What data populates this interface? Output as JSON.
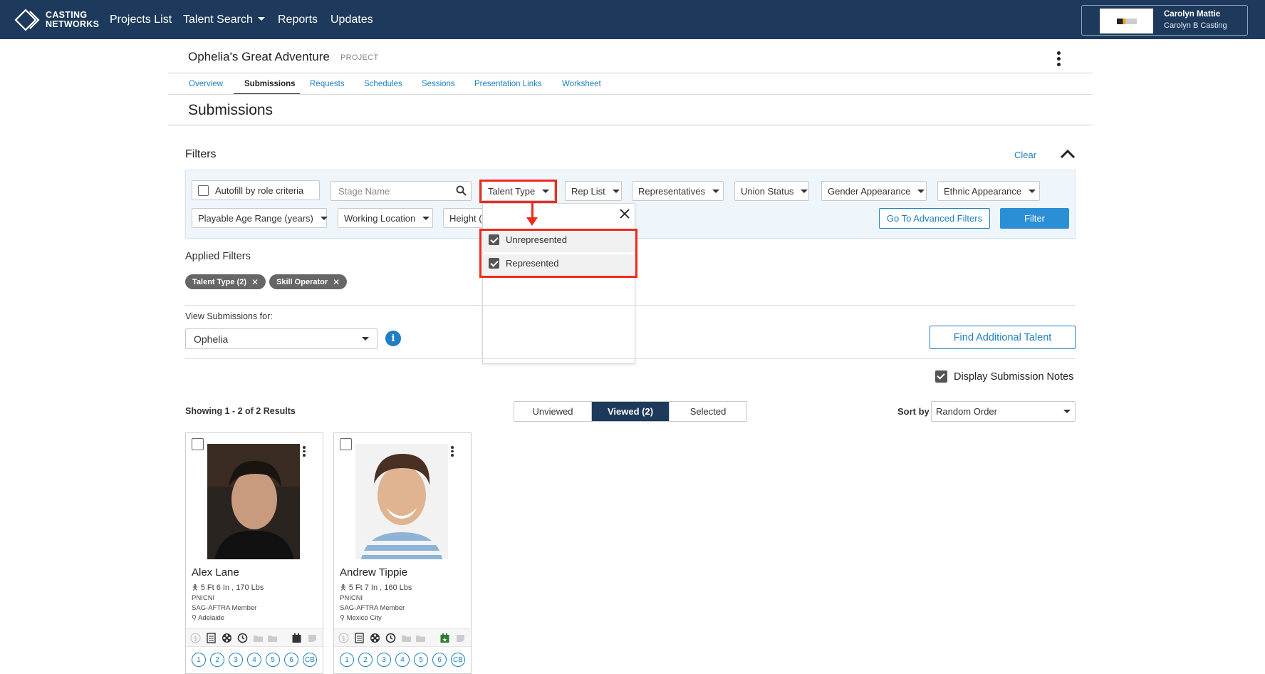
{
  "brand": {
    "line1": "CASTING",
    "line2": "NETWORKS"
  },
  "nav": {
    "projects": "Projects List",
    "talent_search": "Talent Search",
    "reports": "Reports",
    "updates": "Updates"
  },
  "account": {
    "name": "Carolyn Mattie",
    "company": "Carolyn B Casting"
  },
  "project": {
    "title": "Ophelia's Great Adventure",
    "label": "PROJECT"
  },
  "tabs": [
    "Overview",
    "Submissions",
    "Requests",
    "Schedules",
    "Sessions",
    "Presentation Links",
    "Worksheet"
  ],
  "section_title": "Submissions",
  "filters": {
    "title": "Filters",
    "clear": "Clear",
    "autofill": "Autofill by role criteria",
    "stage_name_placeholder": "Stage Name",
    "talent_type": "Talent Type",
    "rep_list": "Rep List",
    "representatives": "Representatives",
    "union_status": "Union Status",
    "gender_appearance": "Gender Appearance",
    "ethnic_appearance": "Ethnic Appearance",
    "playable_age": "Playable Age Range (years)",
    "working_location": "Working Location",
    "height": "Height (",
    "advanced": "Go To Advanced Filters",
    "filter": "Filter"
  },
  "talent_type_options": [
    "Unrepresented",
    "Represented"
  ],
  "applied": {
    "title": "Applied Filters",
    "chips": [
      "Talent Type (2)",
      "Skill Operator"
    ]
  },
  "view_for": {
    "label": "View Submissions for:",
    "value": "Ophelia",
    "info": "i"
  },
  "find_talent": "Find Additional Talent",
  "display_notes": "Display Submission Notes",
  "results": "Showing 1 - 2 of 2 Results",
  "view_tabs": [
    "Unviewed",
    "Viewed (2)",
    "Selected"
  ],
  "sort": {
    "label": "Sort by",
    "value": "Random Order"
  },
  "cards": [
    {
      "name": "Alex Lane",
      "hw": "5 Ft 6 In , 170 Lbs",
      "l1": "PNICNI",
      "l2": "SAG-AFTRA Member",
      "l3": "Adelaide"
    },
    {
      "name": "Andrew Tippie",
      "hw": "5 Ft 7 In , 160 Lbs",
      "l1": "PNICNI",
      "l2": "SAG-AFTRA Member",
      "l3": "Mexico City"
    }
  ],
  "card_numbers": [
    "1",
    "2",
    "3",
    "4",
    "5",
    "6",
    "CB"
  ],
  "colors": {
    "nav": "#1d3a5c",
    "accent": "#1f7fc2",
    "highlight": "#ee2b1d"
  }
}
